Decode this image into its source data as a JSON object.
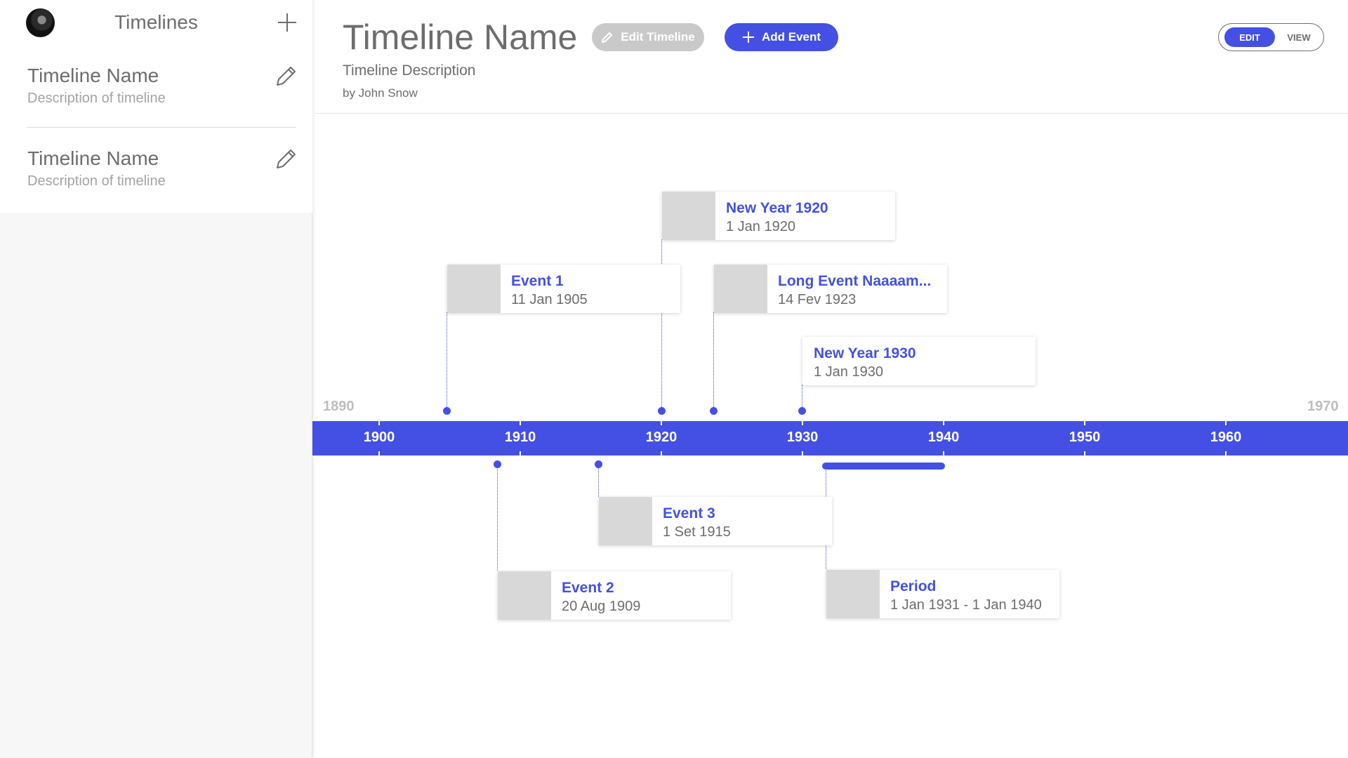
{
  "sidebar": {
    "title": "Timelines",
    "items": [
      {
        "name": "Timeline Name",
        "description": "Description of timeline"
      },
      {
        "name": "Timeline Name",
        "description": "Description of timeline"
      }
    ]
  },
  "header": {
    "title": "Timeline Name",
    "description": "Timeline Description",
    "author": "by John Snow",
    "edit_timeline_label": "Edit Timeline",
    "add_event_label": "Add Event",
    "mode_toggle": {
      "edit_label": "EDIT",
      "view_label": "VIEW",
      "active": "EDIT"
    }
  },
  "timeline": {
    "range_start": "1890",
    "range_end": "1970",
    "ticks": [
      "1900",
      "1910",
      "1920",
      "1930",
      "1940",
      "1950",
      "1960"
    ],
    "events": [
      {
        "title": "New Year 1920",
        "date": "1 Jan 1920"
      },
      {
        "title": "Event 1",
        "date": "11 Jan 1905"
      },
      {
        "title": "Long Event Naaaam...",
        "date": "14 Fev 1923"
      },
      {
        "title": "New Year 1930",
        "date": "1 Jan 1930"
      },
      {
        "title": "Event 3",
        "date": "1 Set 1915"
      },
      {
        "title": "Event 2",
        "date": "20 Aug 1909"
      },
      {
        "title": "Period",
        "date": "1 Jan 1931 - 1 Jan 1940"
      }
    ]
  },
  "colors": {
    "accent": "#4350e3",
    "text": "#6d6d6d",
    "muted": "#a3a3a3",
    "placeholder": "#d8d8d8"
  }
}
